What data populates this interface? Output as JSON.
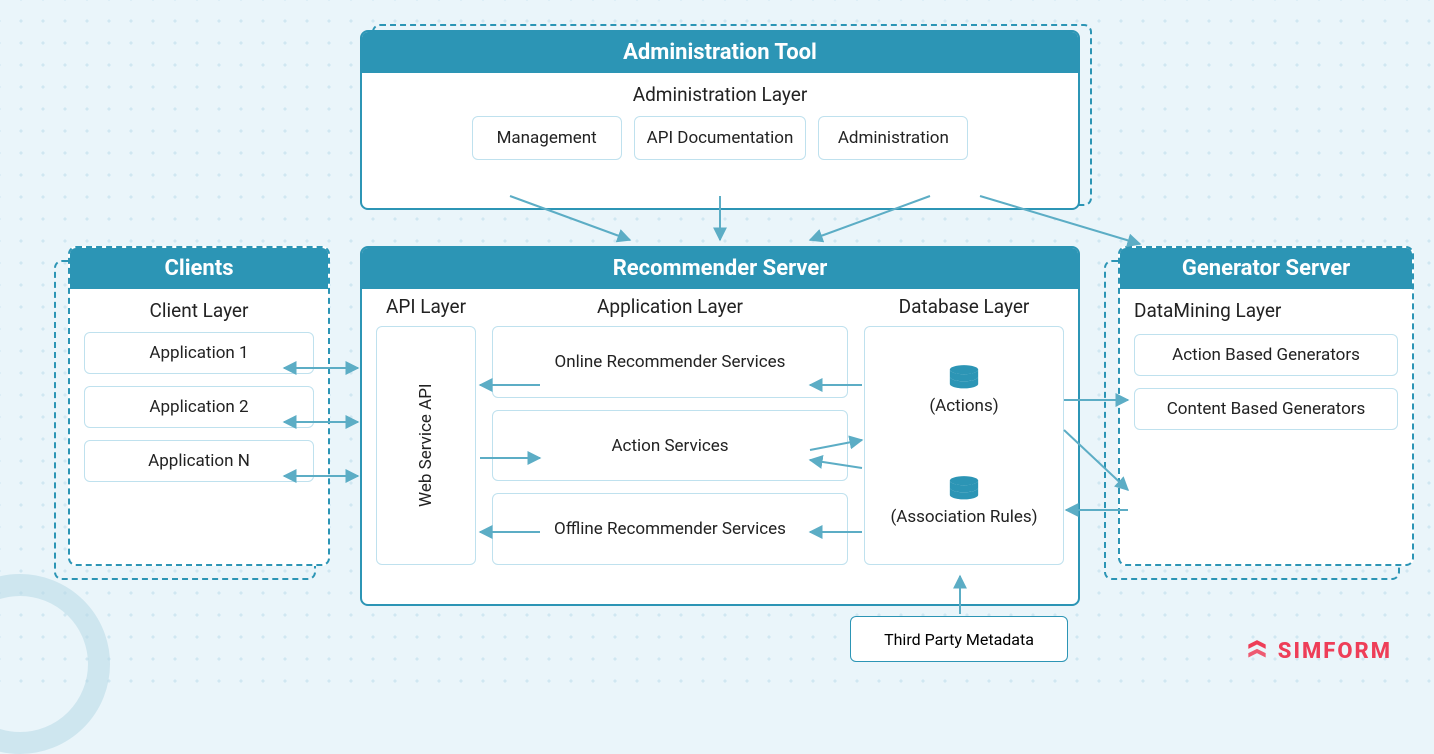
{
  "colors": {
    "accent": "#2c95b5",
    "chip_border": "#bfe1ee",
    "arrow": "#5cadc5",
    "brand": "#ee3e58",
    "bg": "#eaf5fa"
  },
  "admin": {
    "title": "Administration Tool",
    "layer": "Administration Layer",
    "items": [
      "Management",
      "API Documentation",
      "Administration"
    ]
  },
  "clients": {
    "title": "Clients",
    "layer": "Client Layer",
    "items": [
      "Application 1",
      "Application 2",
      "Application N"
    ]
  },
  "rec": {
    "title": "Recommender Server",
    "api": {
      "layer": "API Layer",
      "box": "Web Service API"
    },
    "app": {
      "layer": "Application Layer",
      "items": [
        "Online Recommender Services",
        "Action Services",
        "Offline Recommender Services"
      ]
    },
    "db": {
      "layer": "Database Layer",
      "items": [
        "(Actions)",
        "(Association Rules)"
      ]
    }
  },
  "gen": {
    "title": "Generator Server",
    "layer": "DataMining Layer",
    "items": [
      "Action Based Generators",
      "Content Based Generators"
    ]
  },
  "third_party": "Third Party Metadata",
  "brand": "SIMFORM"
}
